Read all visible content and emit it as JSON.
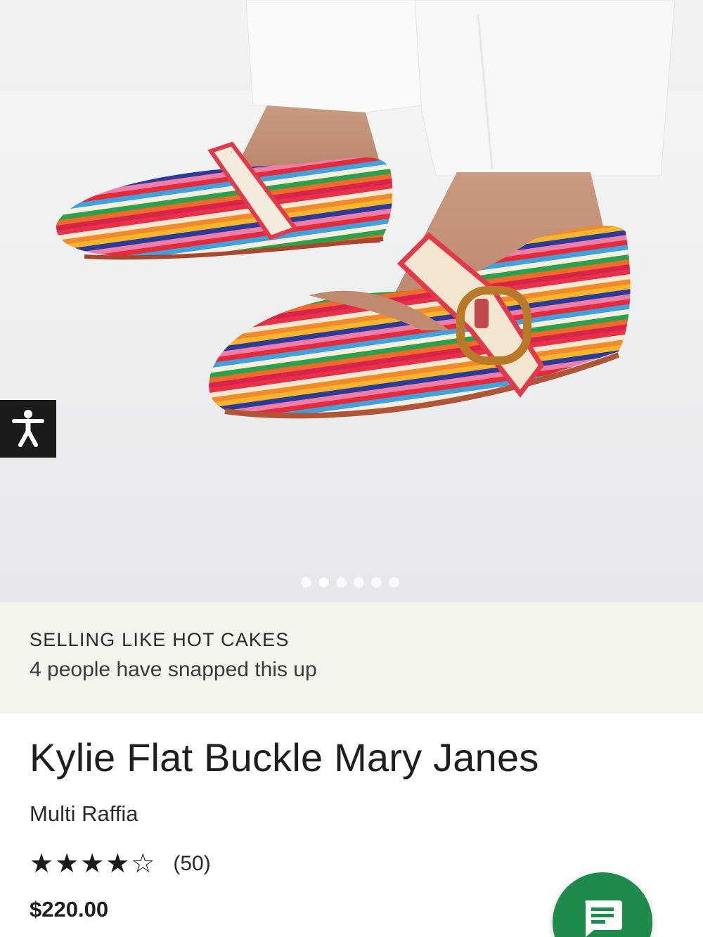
{
  "gallery": {
    "image_alt": "Multi-colour crochet raffia Mary Jane flats with buckle strap",
    "slide_count": 6,
    "active_slide": 2
  },
  "accessibility": {
    "icon": "accessibility-person-icon"
  },
  "promo": {
    "title": "SELLING LIKE HOT CAKES",
    "subtitle": "4 people have snapped this up"
  },
  "product": {
    "title": "Kylie Flat Buckle Mary Janes",
    "variant": "Multi Raffia",
    "rating": 4,
    "rating_max": 5,
    "stars": "★★★★☆",
    "review_count": "(50)",
    "price": "$220.00"
  },
  "chat": {
    "icon": "chat-message-icon"
  },
  "colors": {
    "promo_bg": "#f4f3ec",
    "chat_green": "#1e8a4c",
    "a11y_bg": "#1b1b1b"
  }
}
